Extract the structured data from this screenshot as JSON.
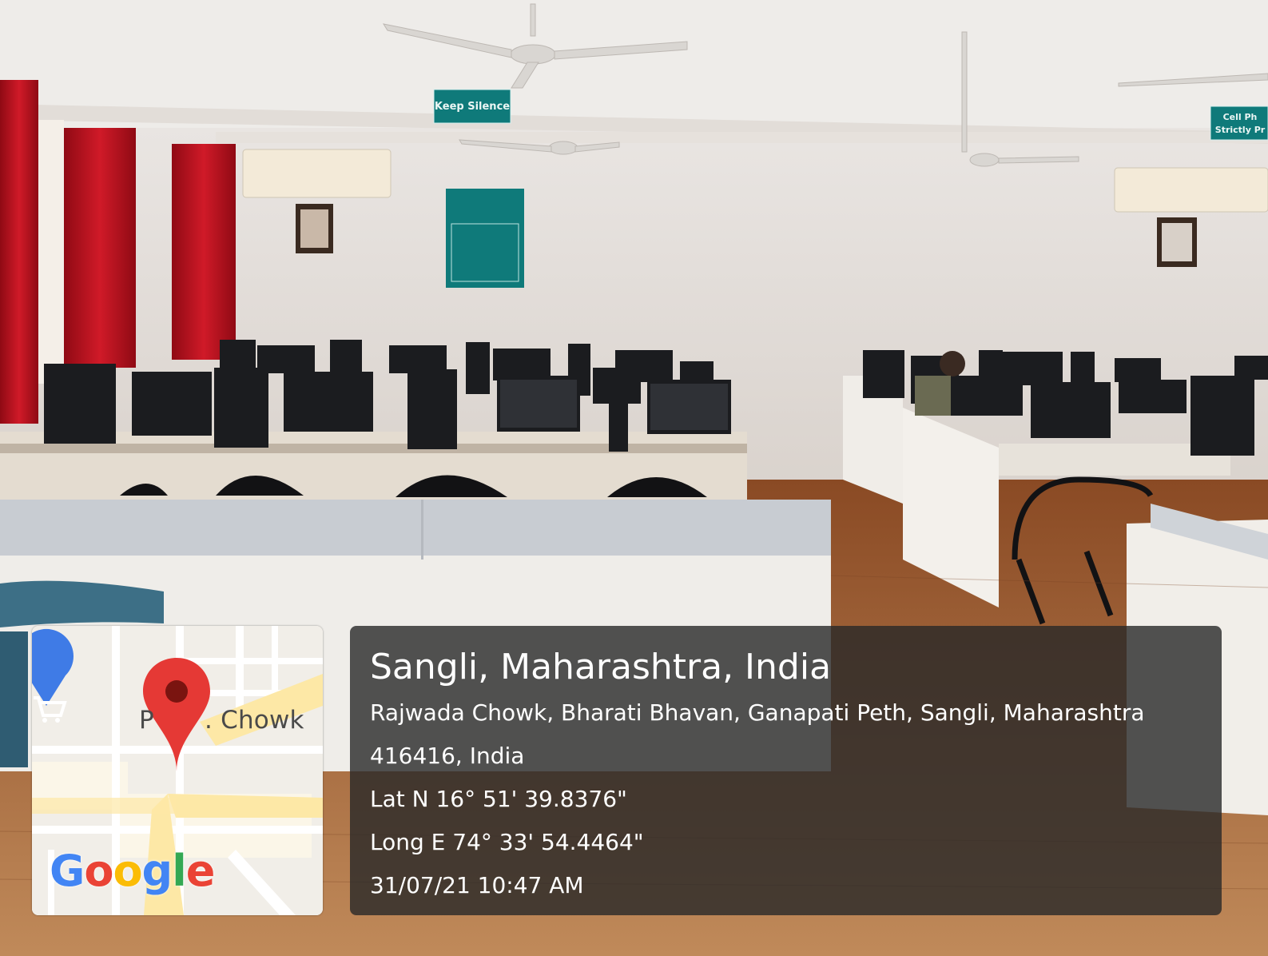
{
  "photo": {
    "signs": {
      "keep_silence": "Keep Silence",
      "cell_phone": "Cell Ph",
      "strictly": "Strictly Pr"
    }
  },
  "map": {
    "place_label_prefix": "P",
    "place_label": ". Chowk",
    "logo_letters": [
      "G",
      "o",
      "o",
      "g",
      "l",
      "e"
    ],
    "pin_icon": "map-pin-icon",
    "cart_icon": "shopping-cart-icon"
  },
  "info": {
    "title": "Sangli, Maharashtra, India",
    "address_line1": "Rajwada Chowk, Bharati Bhavan, Ganapati Peth, Sangli, Maharashtra",
    "address_line2": "416416, India",
    "latitude": "Lat N 16° 51' 39.8376\"",
    "longitude": "Long E 74° 33' 54.4464\"",
    "timestamp": "31/07/21 10:47 AM"
  },
  "colors": {
    "curtain": "#b8101e",
    "wall": "#e8e2dc",
    "floor": "#9a5a32",
    "sign_teal": "#0f7a7a",
    "pin": "#e53935"
  }
}
